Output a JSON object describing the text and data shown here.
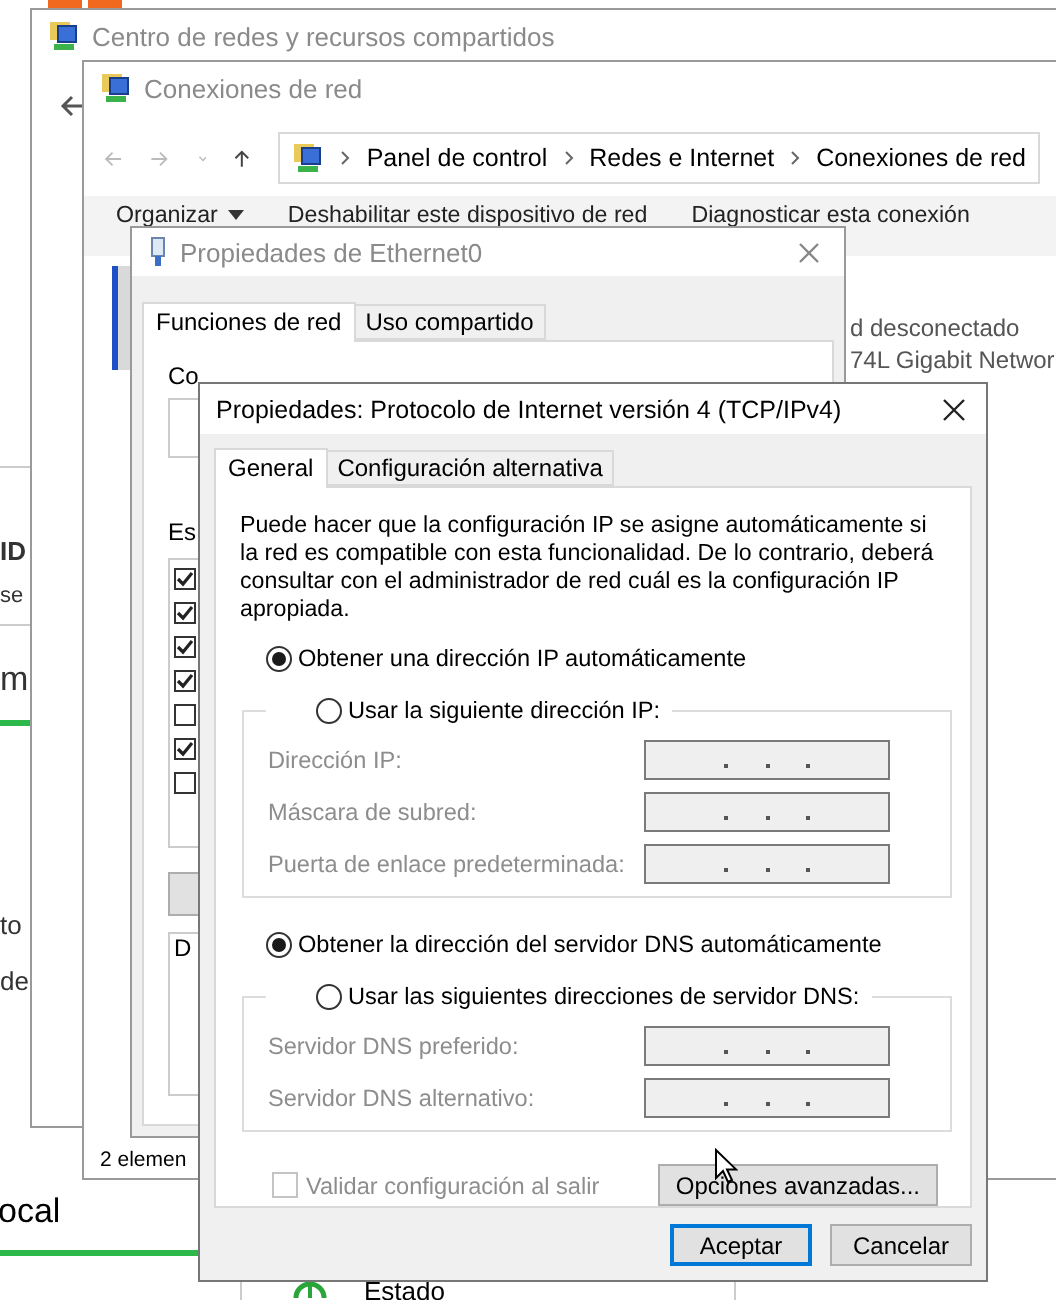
{
  "background": {
    "fragments": [
      {
        "text": "ID",
        "kind": "bold"
      },
      {
        "text": "se",
        "kind": "small"
      },
      {
        "text": "m",
        "kind": "large"
      },
      {
        "text": "to",
        "kind": "plain"
      },
      {
        "text": "de",
        "kind": "plain"
      }
    ],
    "bottom_label": "ocal",
    "status_item": "Estado"
  },
  "network_center": {
    "title": "Centro de redes y recursos compartidos"
  },
  "connections": {
    "title": "Conexiones de red",
    "breadcrumb": [
      "Panel de control",
      "Redes e Internet",
      "Conexiones de red"
    ],
    "toolbar": [
      {
        "label": "Organizar",
        "dropdown": true
      },
      {
        "label": "Deshabilitar este dispositivo de red",
        "dropdown": false
      },
      {
        "label": "Diagnosticar esta conexión",
        "dropdown": false
      }
    ],
    "adapter_lines": [
      "d desconectado",
      "74L Gigabit Networ"
    ],
    "status": "2 elemen"
  },
  "ethernet": {
    "title": "Propiedades de Ethernet0",
    "tabs": [
      {
        "label": "Funciones de red",
        "selected": true
      },
      {
        "label": "Uso compartido",
        "selected": false
      }
    ],
    "connect_label": "Co",
    "items_label": "Es",
    "components": [
      {
        "checked": true
      },
      {
        "checked": true
      },
      {
        "checked": true
      },
      {
        "checked": true
      },
      {
        "checked": false
      },
      {
        "checked": true
      },
      {
        "checked": false
      }
    ],
    "group_label": "D"
  },
  "dialog": {
    "title": "Propiedades: Protocolo de Internet versión 4 (TCP/IPv4)",
    "tabs": [
      {
        "label": "General",
        "selected": true
      },
      {
        "label": "Configuración alternativa",
        "selected": false
      }
    ],
    "description": "Puede hacer que la configuración IP se asigne automáticamente si la red es compatible con esta funcionalidad. De lo contrario, deberá consultar con el administrador de red cuál es la configuración IP apropiada.",
    "ip": {
      "auto": {
        "label": "Obtener una dirección IP automáticamente",
        "selected": true
      },
      "manual": {
        "label": "Usar la siguiente dirección IP:",
        "selected": false
      },
      "disabled": true,
      "fields": [
        {
          "label": "Dirección IP:"
        },
        {
          "label": "Máscara de subred:"
        },
        {
          "label": "Puerta de enlace predeterminada:"
        }
      ]
    },
    "dns": {
      "auto": {
        "label": "Obtener la dirección del servidor DNS automáticamente",
        "selected": true
      },
      "manual": {
        "label": "Usar las siguientes direcciones de servidor DNS:",
        "selected": false
      },
      "disabled": true,
      "fields": [
        {
          "label": "Servidor DNS preferido:"
        },
        {
          "label": "Servidor DNS alternativo:"
        }
      ]
    },
    "validate": {
      "label": "Validar configuración al salir",
      "checked": false,
      "disabled": true
    },
    "advanced": "Opciones avanzadas...",
    "buttons": [
      {
        "label": "Aceptar",
        "default": true
      },
      {
        "label": "Cancelar",
        "default": false
      }
    ]
  }
}
